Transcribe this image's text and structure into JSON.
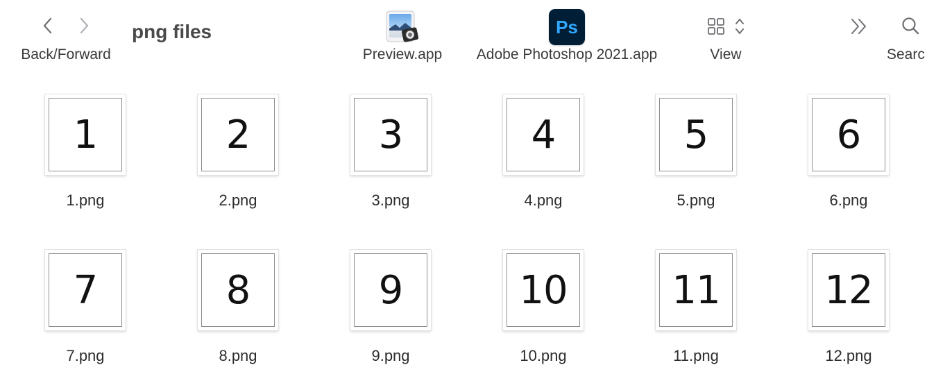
{
  "toolbar": {
    "back_forward_label": "Back/Forward",
    "folder_title": "png files",
    "apps": [
      {
        "label": "Preview.app",
        "icon": "preview-app-icon"
      },
      {
        "label": "Adobe Photoshop 2021.app",
        "icon": "photoshop-app-icon",
        "icon_text": "Ps"
      }
    ],
    "view_label": "View",
    "search_label": "Searc"
  },
  "files": [
    {
      "name": "1.png",
      "thumb": "1"
    },
    {
      "name": "2.png",
      "thumb": "2"
    },
    {
      "name": "3.png",
      "thumb": "3"
    },
    {
      "name": "4.png",
      "thumb": "4"
    },
    {
      "name": "5.png",
      "thumb": "5"
    },
    {
      "name": "6.png",
      "thumb": "6"
    },
    {
      "name": "7.png",
      "thumb": "7"
    },
    {
      "name": "8.png",
      "thumb": "8"
    },
    {
      "name": "9.png",
      "thumb": "9"
    },
    {
      "name": "10.png",
      "thumb": "10"
    },
    {
      "name": "11.png",
      "thumb": "11"
    },
    {
      "name": "12.png",
      "thumb": "12"
    }
  ],
  "colors": {
    "photoshop_bg": "#001e36",
    "photoshop_fg": "#31a8ff",
    "icon_gray": "#6e6e73",
    "disabled_gray": "#b0b0b5"
  }
}
